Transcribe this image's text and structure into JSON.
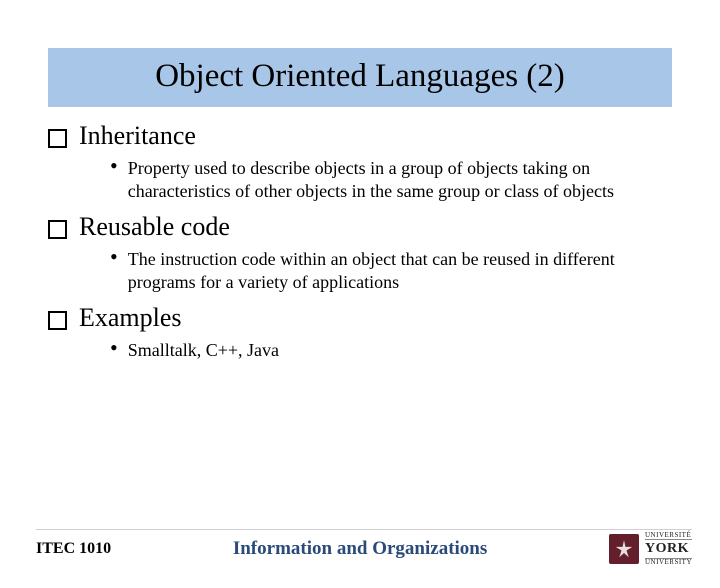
{
  "title": "Object Oriented Languages (2)",
  "items": [
    {
      "label": "Inheritance",
      "sub": "Property used to describe objects in a group of objects taking on characteristics of other objects in the same group or class of objects"
    },
    {
      "label": "Reusable code",
      "sub": "The instruction code within an object that can be reused in different programs for a variety of applications"
    },
    {
      "label": "Examples",
      "sub": "Smalltalk, C++, Java"
    }
  ],
  "footer": {
    "course": "ITEC 1010",
    "subtitle": "Information and Organizations",
    "logo": {
      "top": "UNIVERSITÉ",
      "mid": "YORK",
      "bot": "UNIVERSITY"
    }
  }
}
